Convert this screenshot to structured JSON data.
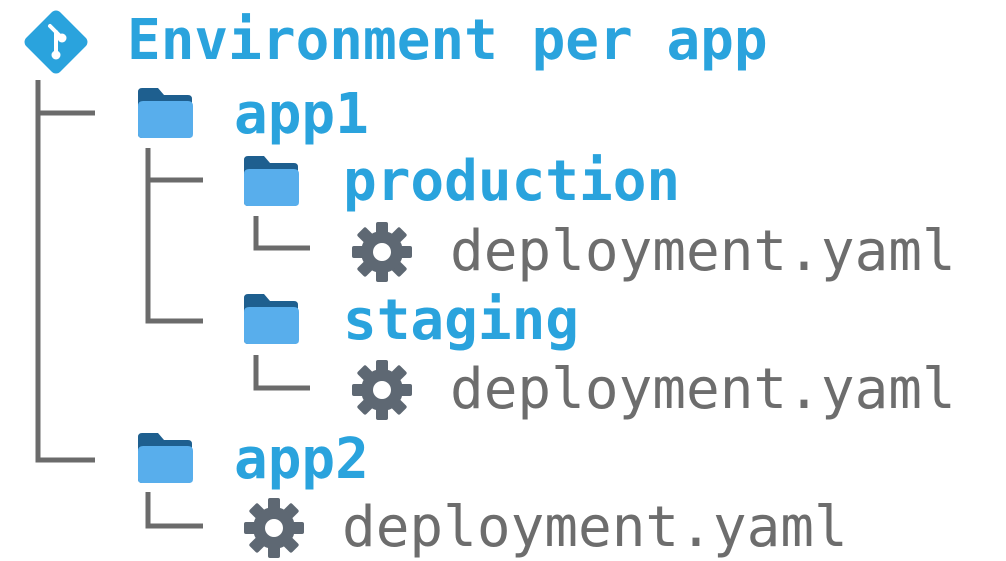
{
  "root": {
    "title": "Environment per app",
    "icon": "git-icon"
  },
  "tree": {
    "app1": {
      "name": "app1",
      "icon": "folder-icon",
      "production": {
        "name": "production",
        "icon": "folder-icon",
        "file": {
          "name": "deployment.yaml",
          "icon": "gear-icon"
        }
      },
      "staging": {
        "name": "staging",
        "icon": "folder-icon",
        "file": {
          "name": "deployment.yaml",
          "icon": "gear-icon"
        }
      }
    },
    "app2": {
      "name": "app2",
      "icon": "folder-icon",
      "file": {
        "name": "deployment.yaml",
        "icon": "gear-icon"
      }
    }
  },
  "colors": {
    "accent": "#2aa3dd",
    "folder_dark": "#1e5f8f",
    "folder_light": "#58aeec",
    "gear": "#5e6873",
    "file_text": "#6d6d6d",
    "tree_line": "#6b6b6b"
  }
}
